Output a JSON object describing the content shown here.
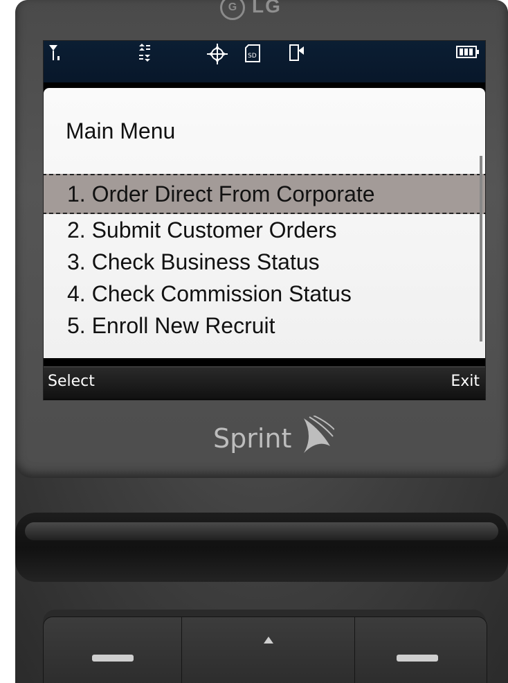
{
  "brand": {
    "manufacturer": "LG",
    "carrier": "Sprint"
  },
  "status_bar": {
    "icons": [
      "signal-icon",
      "data-activity-icon",
      "gps-icon",
      "sd-card-icon",
      "message-icon",
      "battery-icon"
    ]
  },
  "screen": {
    "title": "Main Menu",
    "menu_items": [
      "1. Order Direct From Corporate",
      "2. Submit Customer Orders",
      "3. Check Business Status",
      "4. Check Commission Status",
      "5. Enroll New Recruit"
    ],
    "selected_index": 0
  },
  "softkeys": {
    "left": "Select",
    "right": "Exit"
  },
  "colors": {
    "selection": "#a39b98",
    "status_bar": "#0b1e33"
  }
}
